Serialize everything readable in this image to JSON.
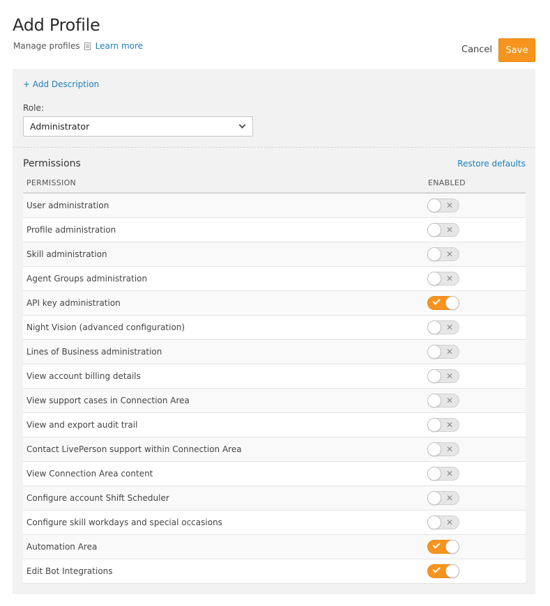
{
  "header": {
    "title": "Add Profile",
    "subtitle": "Manage profiles",
    "learn_more": "Learn more",
    "cancel_label": "Cancel",
    "save_label": "Save"
  },
  "form": {
    "add_description": "+ Add Description",
    "role_label": "Role:",
    "role_value": "Administrator"
  },
  "permissions": {
    "title": "Permissions",
    "restore_label": "Restore defaults",
    "col_permission": "PERMISSION",
    "col_enabled": "ENABLED",
    "rows": [
      {
        "name": "User administration",
        "enabled": false
      },
      {
        "name": "Profile administration",
        "enabled": false
      },
      {
        "name": "Skill administration",
        "enabled": false
      },
      {
        "name": "Agent Groups administration",
        "enabled": false
      },
      {
        "name": "API key administration",
        "enabled": true
      },
      {
        "name": "Night Vision (advanced configuration)",
        "enabled": false
      },
      {
        "name": "Lines of Business administration",
        "enabled": false
      },
      {
        "name": "View account billing details",
        "enabled": false
      },
      {
        "name": "View support cases in Connection Area",
        "enabled": false
      },
      {
        "name": "View and export audit trail",
        "enabled": false
      },
      {
        "name": "Contact LivePerson support within Connection Area",
        "enabled": false
      },
      {
        "name": "View Connection Area content",
        "enabled": false
      },
      {
        "name": "Configure account Shift Scheduler",
        "enabled": false
      },
      {
        "name": "Configure skill workdays and special occasions",
        "enabled": false
      },
      {
        "name": "Automation Area",
        "enabled": true
      },
      {
        "name": "Edit Bot Integrations",
        "enabled": true
      }
    ]
  },
  "colors": {
    "accent": "#f7941d",
    "link": "#1f7fb5",
    "panel_bg": "#f2f2f2"
  }
}
